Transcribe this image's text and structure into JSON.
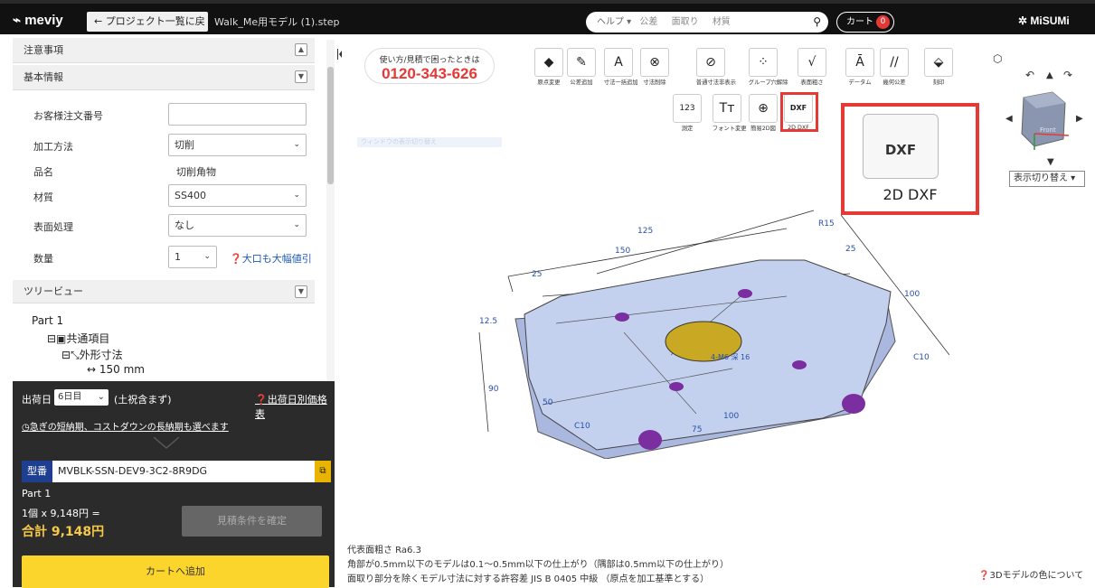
{
  "header": {
    "logo": "meviy",
    "back_label": "← プロジェクト一覧に戻る",
    "filename": "Walk_Me用モデル (1).step",
    "help_label": "ヘルプ ▾",
    "search_terms": [
      "公差",
      "面取り",
      "材質"
    ],
    "cart_label": "カート",
    "cart_count": "0",
    "brand": "MiSUMi"
  },
  "sections": {
    "notes": "注意事項",
    "basic_info": "基本情報",
    "tree_view": "ツリービュー"
  },
  "form": {
    "order_no_label": "お客様注文番号",
    "order_no_value": "",
    "method_label": "加工方法",
    "method_value": "切削",
    "item_label": "品名",
    "item_value": "切削角物",
    "material_label": "材質",
    "material_value": "SS400",
    "surface_label": "表面処理",
    "surface_value": "なし",
    "qty_label": "数量",
    "qty_value": "1",
    "bulk_link": "大口も大幅値引"
  },
  "tree": {
    "root": "Part 1",
    "common": "共通項目",
    "outer_dims": "外形寸法",
    "dim_x": "150 mm"
  },
  "order": {
    "ship_label": "出荷日",
    "ship_value": "6日目",
    "ship_note": "(土祝含まず)",
    "price_table_link": "出荷日別価格表",
    "lead_time_link": "急ぎの短納期、コストダウンの長納期も選べます",
    "part_tag": "型番",
    "part_no": "MVBLK-SSN-DEV9-3C2-8R9DG",
    "part_name": "Part 1",
    "unit_price": "1個 x 9,148円 =",
    "total": "合計 9,148円",
    "confirm_label": "見積条件を確定",
    "add_cart_label": "カートへ追加"
  },
  "viewer": {
    "phone_caption": "使い方/見積で困ったときは",
    "phone_number": "0120-343-626",
    "tools_row1": [
      {
        "label": "原点変更",
        "icon": "origin-icon",
        "glyph": "◆"
      },
      {
        "label": "公差追加",
        "icon": "tolerance-add-icon",
        "glyph": "✎"
      },
      {
        "label": "寸法一括追加",
        "icon": "dimension-bulk-icon",
        "glyph": "A"
      },
      {
        "label": "寸法削除",
        "icon": "dimension-delete-icon",
        "glyph": "⊗"
      },
      {
        "label": "普通寸法非表示",
        "icon": "hide-dimension-icon",
        "glyph": "⊘"
      },
      {
        "label": "グループ穴解除",
        "icon": "group-hole-icon",
        "glyph": "⁘"
      },
      {
        "label": "表面粗さ",
        "icon": "roughness-icon",
        "glyph": "√"
      },
      {
        "label": "データム",
        "icon": "datum-icon",
        "glyph": "Ā"
      },
      {
        "label": "幾何公差",
        "icon": "geometric-tolerance-icon",
        "glyph": "//"
      },
      {
        "label": "刻印",
        "icon": "engrave-icon",
        "glyph": "⬙"
      }
    ],
    "tools_row2": [
      {
        "label": "測定",
        "icon": "measure-icon",
        "glyph": "123"
      },
      {
        "label": "フォント変更",
        "icon": "font-icon",
        "glyph": "Tт"
      },
      {
        "label": "簡易2D図",
        "icon": "simple-2d-icon",
        "glyph": "⊕"
      },
      {
        "label": "2D DXF",
        "icon": "dxf-icon",
        "glyph": "DXF"
      }
    ],
    "zoom_label": "2D DXF",
    "zoom_glyph": "DXF",
    "view_switch": "表示切り替え ▾",
    "faint_text": "ウィンドウの表示切り替え",
    "dims": [
      "125",
      "150",
      "25",
      "R15",
      "25",
      "100",
      "12.5",
      "C10",
      "90",
      "50",
      "C10",
      "75",
      "100",
      "4-M6 深 16"
    ],
    "cube_face": "Front",
    "note1": "代表面粗さ Ra6.3",
    "note2": "角部が0.5mm以下のモデルは0.1〜0.5mm以下の仕上がり（隅部は0.5mm以下の仕上がり）",
    "note3": "面取り部分を除くモデル寸法に対する許容差 JIS B 0405 中級 （原点を加工基準とする）",
    "color_note": "3Dモデルの色について"
  }
}
